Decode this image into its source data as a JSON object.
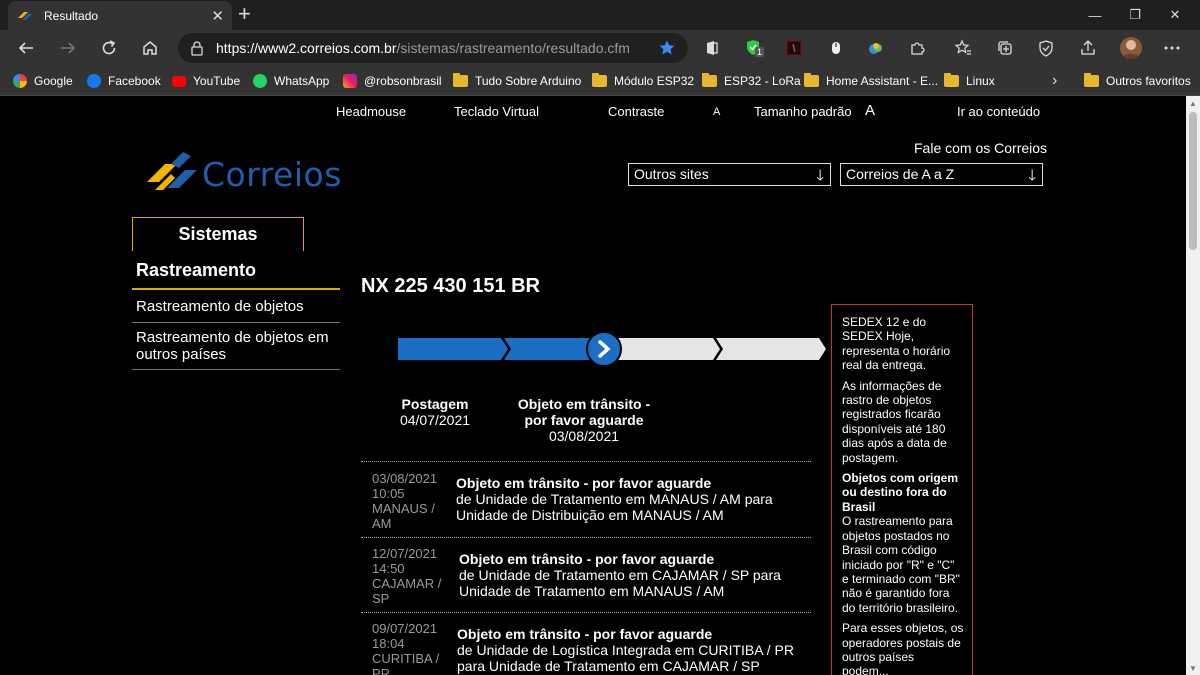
{
  "browser": {
    "tab_title": "Resultado",
    "url_host": "https://www2.correios.com.br",
    "url_path": "/sistemas/rastreamento/resultado.cfm",
    "extension_badge": "1"
  },
  "bookmarks": [
    {
      "label": "Google"
    },
    {
      "label": "Facebook"
    },
    {
      "label": "YouTube"
    },
    {
      "label": "WhatsApp"
    },
    {
      "label": "@robsonbrasil"
    },
    {
      "label": "Tudo Sobre Arduino"
    },
    {
      "label": "Módulo ESP32"
    },
    {
      "label": "ESP32 - LoRa"
    },
    {
      "label": "Home Assistant - E..."
    },
    {
      "label": "Linux"
    },
    {
      "label": "Outros favoritos"
    }
  ],
  "accessibility": {
    "headmouse": "Headmouse",
    "teclado": "Teclado Virtual",
    "contraste": "Contraste",
    "font_small": "A",
    "tamanho": "Tamanho padrão",
    "font_large": "A",
    "ir_conteudo": "Ir ao conteúdo"
  },
  "header": {
    "fale": "Fale com os Correios",
    "logo_text": "Correios",
    "select_outros": "Outros sites",
    "select_az": "Correios de A a Z"
  },
  "sidebar": {
    "tab": "Sistemas",
    "heading": "Rastreamento",
    "link1": "Rastreamento de objetos",
    "link2": "Rastreamento de objetos em outros países"
  },
  "tracking": {
    "code": "NX 225 430 151 BR",
    "progress_steps_completed": 2,
    "progress_steps_total": 4,
    "step1_title": "Postagem",
    "step1_date": "04/07/2021",
    "step2_title": "Objeto em trânsito - por favor aguarde",
    "step2_date": "03/08/2021"
  },
  "events": [
    {
      "date": "03/08/2021",
      "time": "10:05",
      "place": "MANAUS / AM",
      "status": "Objeto em trânsito - por favor aguarde",
      "detail": "de Unidade de Tratamento em MANAUS / AM para Unidade de Distribuição em MANAUS / AM"
    },
    {
      "date": "12/07/2021",
      "time": "14:50",
      "place": "CAJAMAR / SP",
      "status": "Objeto em trânsito - por favor aguarde",
      "detail": "de Unidade de Tratamento em CAJAMAR / SP para Unidade de Tratamento em MANAUS / AM"
    },
    {
      "date": "09/07/2021",
      "time": "18:04",
      "place": "CURITIBA / PR",
      "status": "Objeto em trânsito - por favor aguarde",
      "detail": "de Unidade de Logística Integrada em CURITIBA / PR para Unidade de Tratamento em CAJAMAR / SP"
    }
  ],
  "infobox": {
    "p1": "SEDEX 12 e do SEDEX Hoje, representa o horário real da entrega.",
    "p2": "As informações de rastro de objetos registrados ficarão disponíveis até 180 dias após a data de postagem.",
    "p3_title": "Objetos com origem ou destino fora do Brasil",
    "p3": "O rastreamento para objetos postados no Brasil com código iniciado por \"R\" e \"C\" e terminado com \"BR\" não é garantido fora do território brasileiro.",
    "p4": "Para esses objetos, os operadores postais de outros países podem..."
  },
  "colors": {
    "progress_done": "#1a6fc4",
    "progress_pending": "#e6e6e6",
    "sistemas_border": "#e0a800",
    "infobox_border": "#c0392b",
    "logo_blue": "#1f5ea8",
    "logo_yellow": "#f5b400"
  }
}
